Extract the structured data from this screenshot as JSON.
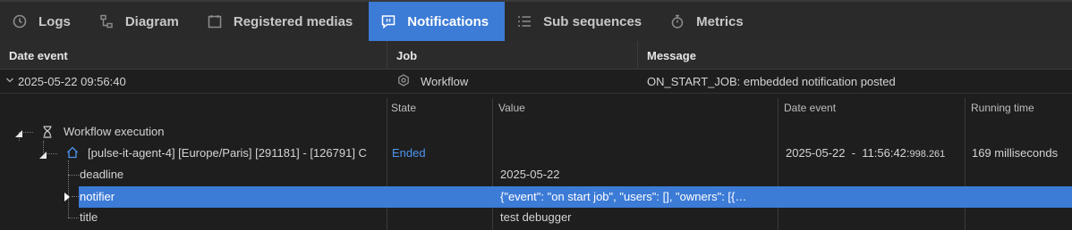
{
  "tabs": [
    {
      "label": "Logs",
      "icon": "clock-icon"
    },
    {
      "label": "Diagram",
      "icon": "diagram-icon"
    },
    {
      "label": "Registered medias",
      "icon": "calendar-icon"
    },
    {
      "label": "Notifications",
      "icon": "message-icon",
      "active": true
    },
    {
      "label": "Sub sequences",
      "icon": "list-icon"
    },
    {
      "label": "Metrics",
      "icon": "stopwatch-icon"
    }
  ],
  "table": {
    "headers": {
      "date": "Date event",
      "job": "Job",
      "message": "Message"
    },
    "row": {
      "date": "2025-05-22 09:56:40",
      "job": "Workflow",
      "message": "ON_START_JOB: embedded notification posted"
    }
  },
  "detail": {
    "headers": {
      "state": "State",
      "value": "Value",
      "date": "Date event",
      "running": "Running time"
    },
    "workflow_label": "Workflow execution",
    "agent": {
      "label": "[pulse-it-agent-4] [Europe/Paris] [291181] - [126791] C",
      "state": "Ended",
      "date": "2025-05-22  -  11:56:42:",
      "date_ms": "998.261",
      "running": "169 milliseconds"
    },
    "fields": [
      {
        "name": "deadline",
        "value": "2025-05-22"
      },
      {
        "name": "notifier",
        "value": "{\"event\": \"on start job\", \"users\": [], \"owners\": [{…",
        "selected": true
      },
      {
        "name": "title",
        "value": "test debugger"
      }
    ]
  },
  "colors": {
    "accent": "#3c7bd6",
    "link": "#4d95f0",
    "background": "#1e1e1e"
  }
}
